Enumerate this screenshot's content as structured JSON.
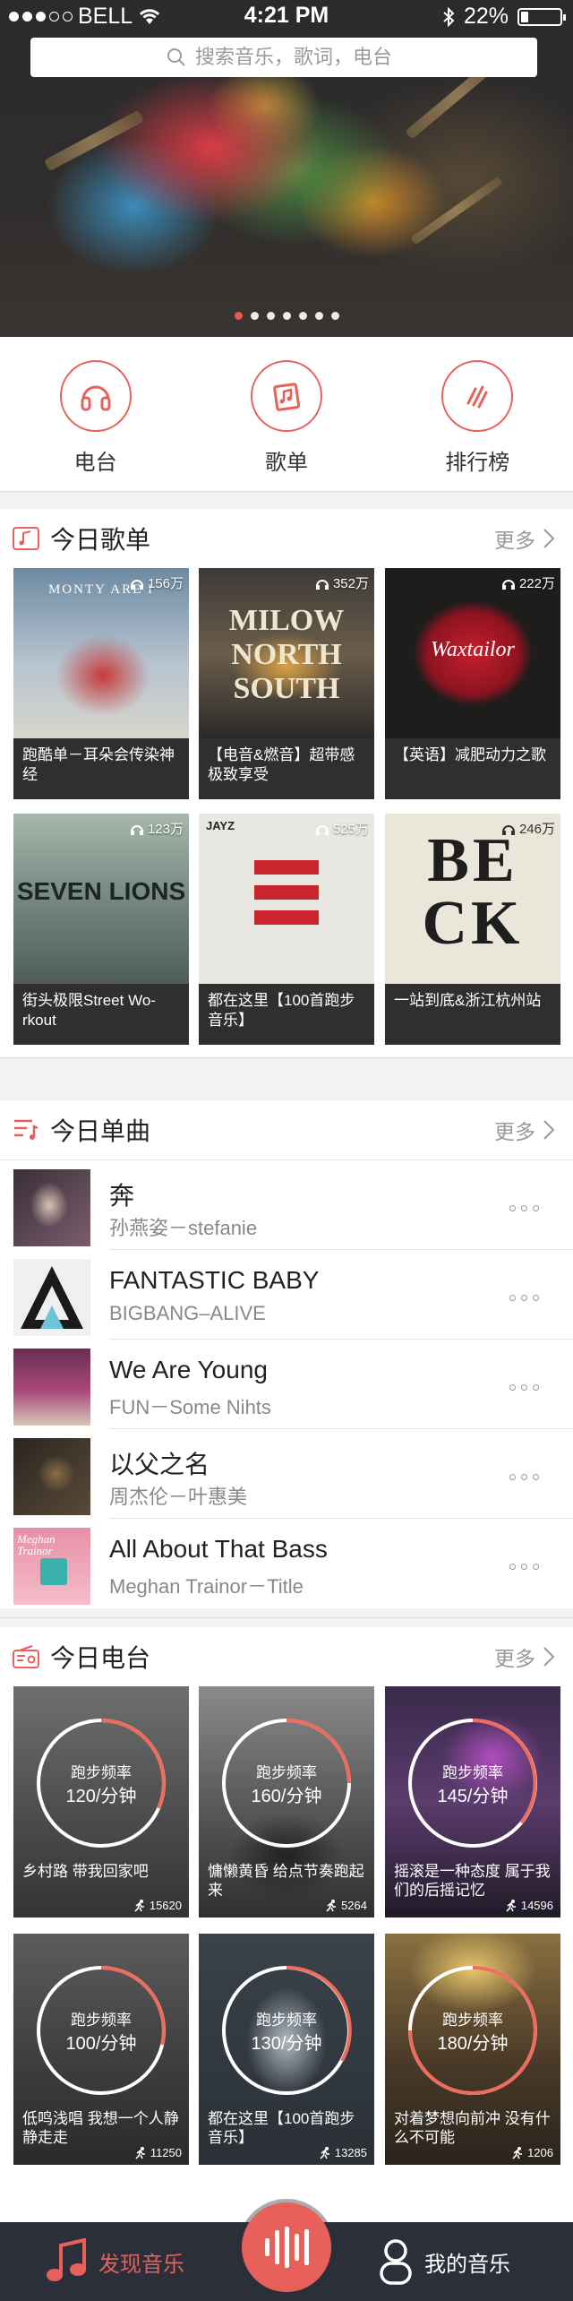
{
  "status_bar": {
    "carrier": "BELL",
    "time": "4:21 PM",
    "battery": "22%"
  },
  "search": {
    "placeholder": "搜索音乐，歌词，电台"
  },
  "banner": {
    "page_count": 7,
    "active_index": 0
  },
  "categories": [
    {
      "label": "电台",
      "icon": "headphones-icon"
    },
    {
      "label": "歌单",
      "icon": "playlist-icon"
    },
    {
      "label": "排行榜",
      "icon": "chart-icon"
    }
  ],
  "playlists": {
    "title": "今日歌单",
    "more": "更多",
    "items": [
      {
        "count": "156万",
        "caption": "跑酷单－耳朵会传染神经",
        "art": "MONTY ARE I"
      },
      {
        "count": "352万",
        "caption": "【电音&燃音】超带感极致享受",
        "art": "MILOW NORTH SOUTH"
      },
      {
        "count": "222万",
        "caption": "【英语】减肥动力之歌",
        "art": "Waxtailor"
      },
      {
        "count": "123万",
        "caption": "街头极限Street Wo-rkout",
        "art": "SEVEN LIONS"
      },
      {
        "count": "525万",
        "caption": "都在这里【100首跑步音乐】",
        "art": "JAYZ"
      },
      {
        "count": "246万",
        "caption": "一站到底&浙江杭州站",
        "art": "BECK"
      }
    ]
  },
  "songs": {
    "title": "今日单曲",
    "more": "更多",
    "items": [
      {
        "name": "奔",
        "artist": "孙燕姿－stefanie"
      },
      {
        "name": "FANTASTIC BABY",
        "artist": "BIGBANG–ALIVE"
      },
      {
        "name": "We Are Young",
        "artist": "FUN－Some Nihts"
      },
      {
        "name": "以父之名",
        "artist": "周杰伦－叶惠美"
      },
      {
        "name": "All About That Bass",
        "artist": "Meghan Trainor－Title",
        "art": "Meghan Trainor"
      }
    ]
  },
  "radios": {
    "title": "今日电台",
    "more": "更多",
    "items": [
      {
        "rate_label": "跑步频率",
        "bpm": "120/分钟",
        "caption": "乡村路 带我回家吧",
        "runners": "15620"
      },
      {
        "rate_label": "跑步频率",
        "bpm": "160/分钟",
        "caption": "慵懒黄昏 给点节奏跑起来",
        "runners": "5264"
      },
      {
        "rate_label": "跑步频率",
        "bpm": "145/分钟",
        "caption": "摇滚是一种态度 属于我们的后摇记忆",
        "runners": "14596"
      },
      {
        "rate_label": "跑步频率",
        "bpm": "100/分钟",
        "caption": "低鸣浅唱 我想一个人静静走走",
        "runners": "11250"
      },
      {
        "rate_label": "跑步频率",
        "bpm": "130/分钟",
        "caption": "都在这里【100首跑步音乐】",
        "runners": "13285"
      },
      {
        "rate_label": "跑步频率",
        "bpm": "180/分钟",
        "caption": "对着梦想向前冲 没有什么不可能",
        "runners": "1206"
      }
    ]
  },
  "tabbar": {
    "discover": "发现音乐",
    "mine": "我的音乐"
  },
  "colors": {
    "accent": "#e8605a",
    "tabbar": "#2b2f3a"
  }
}
